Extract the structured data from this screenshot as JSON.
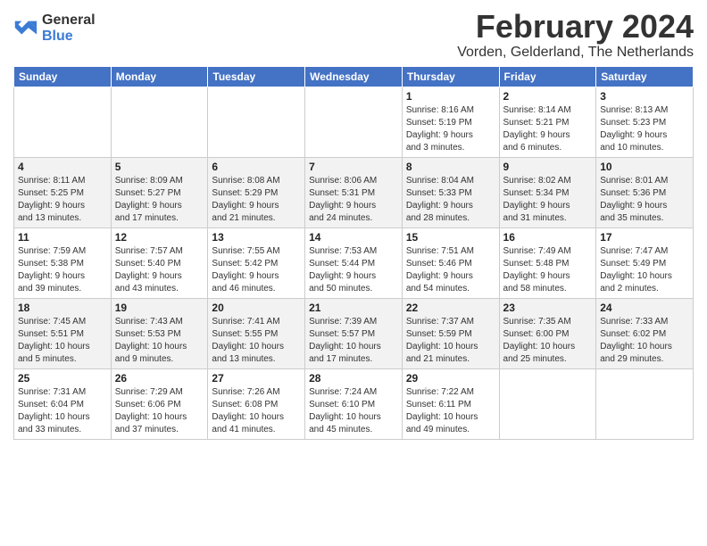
{
  "header": {
    "logo_line1": "General",
    "logo_line2": "Blue",
    "month": "February 2024",
    "location": "Vorden, Gelderland, The Netherlands"
  },
  "weekdays": [
    "Sunday",
    "Monday",
    "Tuesday",
    "Wednesday",
    "Thursday",
    "Friday",
    "Saturday"
  ],
  "weeks": [
    [
      {
        "day": "",
        "info": ""
      },
      {
        "day": "",
        "info": ""
      },
      {
        "day": "",
        "info": ""
      },
      {
        "day": "",
        "info": ""
      },
      {
        "day": "1",
        "info": "Sunrise: 8:16 AM\nSunset: 5:19 PM\nDaylight: 9 hours\nand 3 minutes."
      },
      {
        "day": "2",
        "info": "Sunrise: 8:14 AM\nSunset: 5:21 PM\nDaylight: 9 hours\nand 6 minutes."
      },
      {
        "day": "3",
        "info": "Sunrise: 8:13 AM\nSunset: 5:23 PM\nDaylight: 9 hours\nand 10 minutes."
      }
    ],
    [
      {
        "day": "4",
        "info": "Sunrise: 8:11 AM\nSunset: 5:25 PM\nDaylight: 9 hours\nand 13 minutes."
      },
      {
        "day": "5",
        "info": "Sunrise: 8:09 AM\nSunset: 5:27 PM\nDaylight: 9 hours\nand 17 minutes."
      },
      {
        "day": "6",
        "info": "Sunrise: 8:08 AM\nSunset: 5:29 PM\nDaylight: 9 hours\nand 21 minutes."
      },
      {
        "day": "7",
        "info": "Sunrise: 8:06 AM\nSunset: 5:31 PM\nDaylight: 9 hours\nand 24 minutes."
      },
      {
        "day": "8",
        "info": "Sunrise: 8:04 AM\nSunset: 5:33 PM\nDaylight: 9 hours\nand 28 minutes."
      },
      {
        "day": "9",
        "info": "Sunrise: 8:02 AM\nSunset: 5:34 PM\nDaylight: 9 hours\nand 31 minutes."
      },
      {
        "day": "10",
        "info": "Sunrise: 8:01 AM\nSunset: 5:36 PM\nDaylight: 9 hours\nand 35 minutes."
      }
    ],
    [
      {
        "day": "11",
        "info": "Sunrise: 7:59 AM\nSunset: 5:38 PM\nDaylight: 9 hours\nand 39 minutes."
      },
      {
        "day": "12",
        "info": "Sunrise: 7:57 AM\nSunset: 5:40 PM\nDaylight: 9 hours\nand 43 minutes."
      },
      {
        "day": "13",
        "info": "Sunrise: 7:55 AM\nSunset: 5:42 PM\nDaylight: 9 hours\nand 46 minutes."
      },
      {
        "day": "14",
        "info": "Sunrise: 7:53 AM\nSunset: 5:44 PM\nDaylight: 9 hours\nand 50 minutes."
      },
      {
        "day": "15",
        "info": "Sunrise: 7:51 AM\nSunset: 5:46 PM\nDaylight: 9 hours\nand 54 minutes."
      },
      {
        "day": "16",
        "info": "Sunrise: 7:49 AM\nSunset: 5:48 PM\nDaylight: 9 hours\nand 58 minutes."
      },
      {
        "day": "17",
        "info": "Sunrise: 7:47 AM\nSunset: 5:49 PM\nDaylight: 10 hours\nand 2 minutes."
      }
    ],
    [
      {
        "day": "18",
        "info": "Sunrise: 7:45 AM\nSunset: 5:51 PM\nDaylight: 10 hours\nand 5 minutes."
      },
      {
        "day": "19",
        "info": "Sunrise: 7:43 AM\nSunset: 5:53 PM\nDaylight: 10 hours\nand 9 minutes."
      },
      {
        "day": "20",
        "info": "Sunrise: 7:41 AM\nSunset: 5:55 PM\nDaylight: 10 hours\nand 13 minutes."
      },
      {
        "day": "21",
        "info": "Sunrise: 7:39 AM\nSunset: 5:57 PM\nDaylight: 10 hours\nand 17 minutes."
      },
      {
        "day": "22",
        "info": "Sunrise: 7:37 AM\nSunset: 5:59 PM\nDaylight: 10 hours\nand 21 minutes."
      },
      {
        "day": "23",
        "info": "Sunrise: 7:35 AM\nSunset: 6:00 PM\nDaylight: 10 hours\nand 25 minutes."
      },
      {
        "day": "24",
        "info": "Sunrise: 7:33 AM\nSunset: 6:02 PM\nDaylight: 10 hours\nand 29 minutes."
      }
    ],
    [
      {
        "day": "25",
        "info": "Sunrise: 7:31 AM\nSunset: 6:04 PM\nDaylight: 10 hours\nand 33 minutes."
      },
      {
        "day": "26",
        "info": "Sunrise: 7:29 AM\nSunset: 6:06 PM\nDaylight: 10 hours\nand 37 minutes."
      },
      {
        "day": "27",
        "info": "Sunrise: 7:26 AM\nSunset: 6:08 PM\nDaylight: 10 hours\nand 41 minutes."
      },
      {
        "day": "28",
        "info": "Sunrise: 7:24 AM\nSunset: 6:10 PM\nDaylight: 10 hours\nand 45 minutes."
      },
      {
        "day": "29",
        "info": "Sunrise: 7:22 AM\nSunset: 6:11 PM\nDaylight: 10 hours\nand 49 minutes."
      },
      {
        "day": "",
        "info": ""
      },
      {
        "day": "",
        "info": ""
      }
    ]
  ]
}
